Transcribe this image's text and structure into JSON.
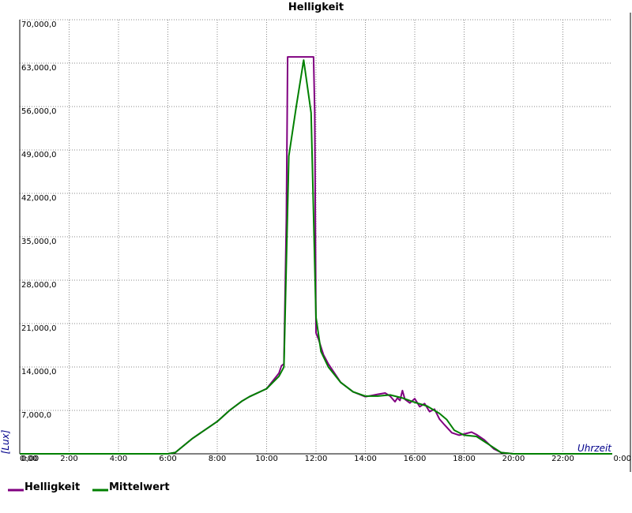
{
  "chart_data": {
    "type": "line",
    "title": "Helligkeit",
    "xlabel": "Uhrzeit",
    "ylabel": "[Lux]",
    "xlim": [
      0,
      24
    ],
    "ylim": [
      0,
      70000
    ],
    "grid": true,
    "legend_position": "bottom-left",
    "x_ticks": [
      "0:00",
      "2:00",
      "4:00",
      "6:00",
      "8:00",
      "10:00",
      "12:00",
      "14:00",
      "16:00",
      "18:00",
      "20:00",
      "22:00",
      "0:00"
    ],
    "y_ticks": [
      "0,00",
      "7,000,0",
      "14,000,0",
      "21,000,0",
      "28,000,0",
      "35,000,0",
      "42,000,0",
      "49,000,0",
      "56,000,0",
      "63,000,0",
      "70,000,0"
    ],
    "series": [
      {
        "name": "Helligkeit",
        "color": "#800080",
        "x": [
          0,
          6.0,
          6.3,
          7.0,
          8.0,
          8.5,
          9.0,
          9.3,
          10.0,
          10.5,
          10.6,
          10.7,
          10.8,
          10.85,
          10.9,
          11.5,
          11.9,
          11.95,
          12.0,
          12.1,
          12.3,
          12.5,
          13.0,
          13.5,
          14.0,
          14.5,
          14.8,
          15.0,
          15.2,
          15.3,
          15.4,
          15.5,
          15.6,
          15.8,
          16.0,
          16.2,
          16.4,
          16.6,
          16.8,
          17.0,
          17.2,
          17.5,
          17.8,
          18.0,
          18.3,
          18.5,
          18.8,
          19.2,
          19.5,
          20.0,
          24.0
        ],
        "y": [
          0,
          0,
          200,
          2500,
          5200,
          7000,
          8500,
          9200,
          10500,
          13000,
          14200,
          14500,
          38000,
          64000,
          64000,
          64000,
          64000,
          55000,
          19500,
          18500,
          16000,
          14500,
          11500,
          10000,
          9200,
          9600,
          9800,
          9300,
          8400,
          9000,
          8600,
          10200,
          8800,
          8200,
          8900,
          7600,
          8100,
          6800,
          7200,
          5600,
          4700,
          3400,
          3000,
          3200,
          3500,
          3100,
          2300,
          800,
          200,
          0,
          0
        ]
      },
      {
        "name": "Mittelwert",
        "color": "#008000",
        "x": [
          0,
          6.0,
          6.3,
          7.0,
          8.0,
          8.5,
          9.0,
          9.3,
          10.0,
          10.5,
          10.7,
          10.9,
          11.2,
          11.5,
          11.8,
          12.0,
          12.2,
          12.5,
          13.0,
          13.5,
          14.0,
          14.5,
          15.0,
          15.5,
          16.0,
          16.5,
          17.0,
          17.3,
          17.6,
          18.0,
          18.5,
          19.0,
          19.5,
          20.0,
          24.0
        ],
        "y": [
          0,
          0,
          200,
          2500,
          5200,
          7000,
          8500,
          9200,
          10500,
          12500,
          14000,
          48000,
          56000,
          63500,
          55000,
          22000,
          16500,
          14000,
          11500,
          10000,
          9300,
          9300,
          9500,
          9000,
          8300,
          7700,
          6500,
          5500,
          3800,
          3000,
          2800,
          1500,
          200,
          0,
          0
        ]
      }
    ]
  }
}
